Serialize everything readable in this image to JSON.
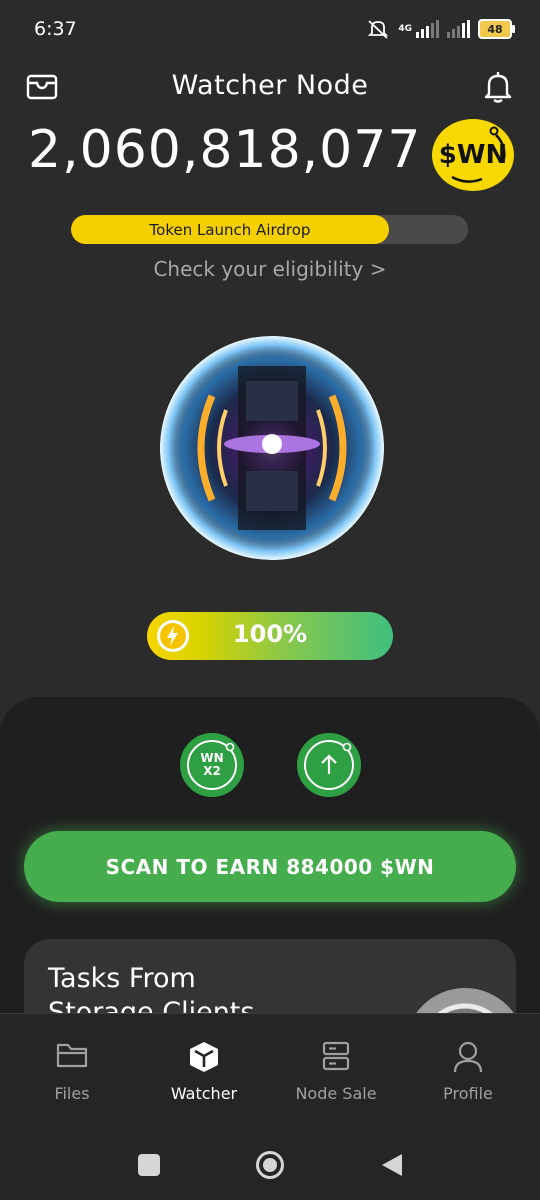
{
  "status_bar": {
    "time": "6:37",
    "network": "4G",
    "battery": "48"
  },
  "header": {
    "title": "Watcher Node"
  },
  "balance": {
    "amount": "2,060,818,077",
    "token_label": "$WN"
  },
  "airdrop": {
    "label": "Token Launch Airdrop",
    "progress_fraction": 0.8,
    "eligibility_link": "Check your eligibility >"
  },
  "energy": {
    "value": "100%"
  },
  "boosts": {
    "multiplier_line1": "WN",
    "multiplier_line2": "X2"
  },
  "scan": {
    "label": "SCAN TO EARN 884000 $WN"
  },
  "tasks": {
    "title": "Tasks From Storage Clients"
  },
  "nav": {
    "items": [
      {
        "label": "Files",
        "icon": "folder-icon"
      },
      {
        "label": "Watcher",
        "icon": "cube-icon",
        "active": true
      },
      {
        "label": "Node Sale",
        "icon": "server-icon"
      },
      {
        "label": "Profile",
        "icon": "user-icon"
      }
    ]
  },
  "colors": {
    "background": "#2b2b2b",
    "accent_yellow": "#f5d000",
    "accent_green": "#45ad4d"
  }
}
